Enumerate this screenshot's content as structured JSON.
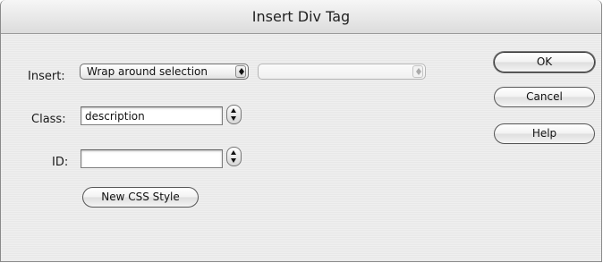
{
  "window": {
    "title": "Insert Div Tag"
  },
  "insert": {
    "label": "Insert:",
    "selected": "Wrap around selection",
    "second_selected": ""
  },
  "class": {
    "label": "Class:",
    "value": "description"
  },
  "id": {
    "label": "ID:",
    "value": ""
  },
  "new_css_style_label": "New CSS Style",
  "buttons": {
    "ok": "OK",
    "cancel": "Cancel",
    "help": "Help"
  },
  "icons": {
    "popup_arrows": "up-down-arrows-icon",
    "stepper": "stepper-arrows-icon"
  }
}
